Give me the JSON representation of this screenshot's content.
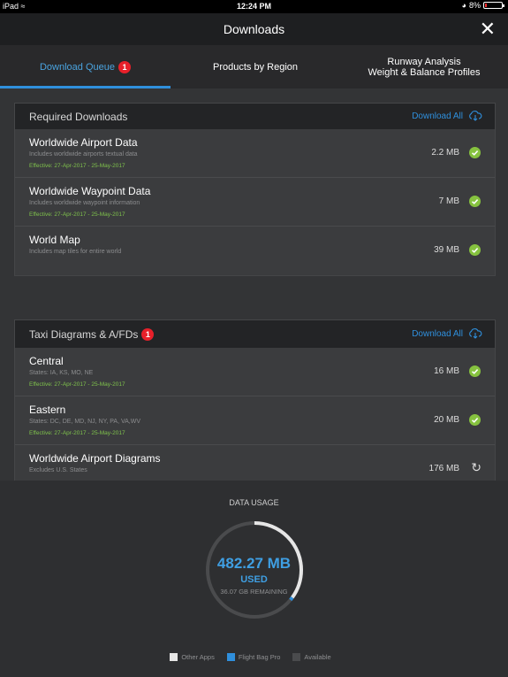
{
  "status_bar": {
    "device": "iPad",
    "time": "12:24 PM",
    "battery": "8%"
  },
  "nav": {
    "title": "Downloads",
    "close_icon": "close-icon"
  },
  "tabs": [
    {
      "label": "Download Queue",
      "badge": "1",
      "active": true
    },
    {
      "label": "Products by Region"
    },
    {
      "label_line1": "Runway Analysis",
      "label_line2": "Weight & Balance Profiles"
    }
  ],
  "required": {
    "header": "Required Downloads",
    "download_all": "Download All",
    "rows": [
      {
        "title": "Worldwide Airport Data",
        "sub": "Includes worldwide airports textual data",
        "effective": "Effective: 27-Apr-2017 - 25-May-2017",
        "size": "2.2 MB",
        "status": "complete"
      },
      {
        "title": "Worldwide Waypoint Data",
        "sub": "Includes worldwide waypoint information",
        "effective": "Effective: 27-Apr-2017 - 25-May-2017",
        "size": "7 MB",
        "status": "complete"
      },
      {
        "title": "World Map",
        "sub": "Includes map tiles for entire world",
        "size": "39 MB",
        "status": "complete"
      }
    ]
  },
  "taxi": {
    "header": "Taxi Diagrams & A/FDs",
    "badge": "1",
    "download_all": "Download All",
    "rows": [
      {
        "title": "Central",
        "sub": "States: IA, KS, MO, NE",
        "effective": "Effective: 27-Apr-2017 - 25-May-2017",
        "size": "16 MB",
        "status": "complete"
      },
      {
        "title": "Eastern",
        "sub": "States: DC, DE, MD, NJ, NY, PA, VA,WV",
        "effective": "Effective: 27-Apr-2017 - 25-May-2017",
        "size": "20 MB",
        "status": "complete"
      },
      {
        "title": "Worldwide Airport Diagrams",
        "sub": "Excludes U.S. States",
        "size": "176 MB",
        "status": "pending"
      }
    ]
  },
  "usage": {
    "title": "DATA USAGE",
    "used": "482.27 MB",
    "used_label": "USED",
    "remaining": "36.07 GB REMAINING",
    "ring": {
      "other_apps_fraction": 0.35,
      "flight_bag_fraction": 0.01
    },
    "legend": [
      {
        "label": "Other Apps",
        "color": "#e6e6e6"
      },
      {
        "label": "Flight Bag Pro",
        "color": "#2f8fdc"
      },
      {
        "label": "Available",
        "color": "#4a4b4d"
      }
    ]
  }
}
